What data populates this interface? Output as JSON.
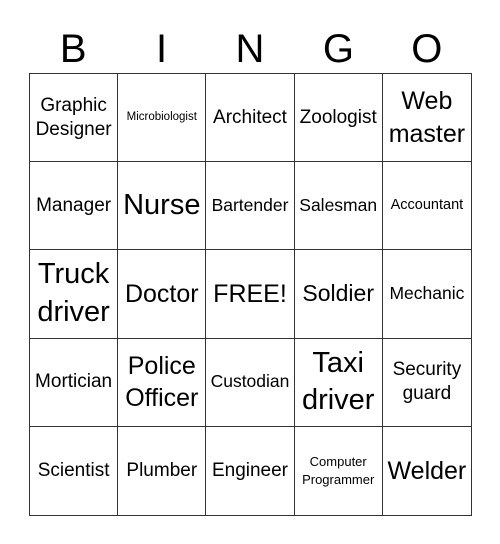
{
  "header": [
    "B",
    "I",
    "N",
    "G",
    "O"
  ],
  "cells": [
    "Graphic Designer",
    "Microbiologist",
    "Architect",
    "Zoologist",
    "Web master",
    "Manager",
    "Nurse",
    "Bartender",
    "Salesman",
    "Accountant",
    "Truck driver",
    "Doctor",
    "FREE!",
    "Soldier",
    "Mechanic",
    "Mortician",
    "Police Officer",
    "Custodian",
    "Taxi driver",
    "Security guard",
    "Scientist",
    "Plumber",
    "Engineer",
    "Computer Programmer",
    "Welder"
  ]
}
